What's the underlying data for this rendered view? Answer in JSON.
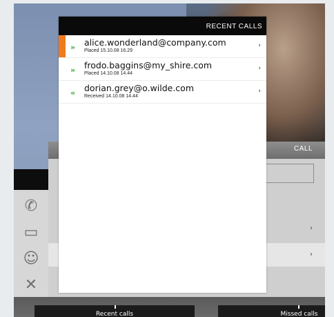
{
  "recent_calls": {
    "title": "RECENT CALLS",
    "entries": [
      {
        "address": "alice.wonderland@company.com",
        "status": "Placed 15.10.08 16.29",
        "direction_icon": "placed-arrow-icon",
        "selected": true
      },
      {
        "address": "frodo.baggins@my_shire.com",
        "status": "Placed 14.10.08 14.44",
        "direction_icon": "placed-arrow-icon",
        "selected": false
      },
      {
        "address": "dorian.grey@o.wilde.com",
        "status": "Received 14.10.08 14.44",
        "direction_icon": "received-arrow-icon",
        "selected": false
      }
    ],
    "chevron": "›",
    "placed_glyph": "»",
    "received_glyph": "«"
  },
  "call_panel": {
    "title": "CALL"
  },
  "side_icons": [
    "phone-icon",
    "laptop-icon",
    "contact-icon",
    "tools-icon"
  ],
  "bottom_bar": {
    "left_label": "Recent calls",
    "right_label": "Missed calls"
  },
  "colors": {
    "accent": "#f07a1c",
    "direction_arrow": "#3aaa35"
  }
}
